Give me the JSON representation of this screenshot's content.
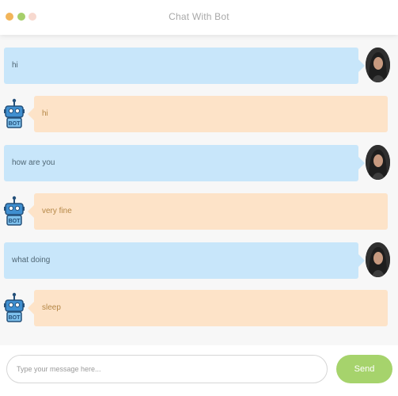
{
  "window": {
    "title": "Chat With Bot",
    "controls": [
      "close-dot",
      "minimize-dot",
      "maximize-dot"
    ]
  },
  "messages": [
    {
      "sender": "user",
      "text": "hi",
      "avatar_icon": "user-avatar-icon"
    },
    {
      "sender": "bot",
      "text": "hi",
      "avatar_icon": "robot-icon"
    },
    {
      "sender": "user",
      "text": "how are you",
      "avatar_icon": "user-avatar-icon"
    },
    {
      "sender": "bot",
      "text": "very fine",
      "avatar_icon": "robot-icon"
    },
    {
      "sender": "user",
      "text": "what doing",
      "avatar_icon": "user-avatar-icon"
    },
    {
      "sender": "bot",
      "text": "sleep",
      "avatar_icon": "robot-icon"
    }
  ],
  "composer": {
    "placeholder": "Type your message here...",
    "value": "",
    "send_label": "Send"
  },
  "bot_badge_text": "BOT",
  "colors": {
    "user_bubble": "#c8e6fa",
    "bot_bubble": "#fde3c8",
    "send_button": "#a6d36c",
    "chat_background": "#f7f7f7"
  }
}
